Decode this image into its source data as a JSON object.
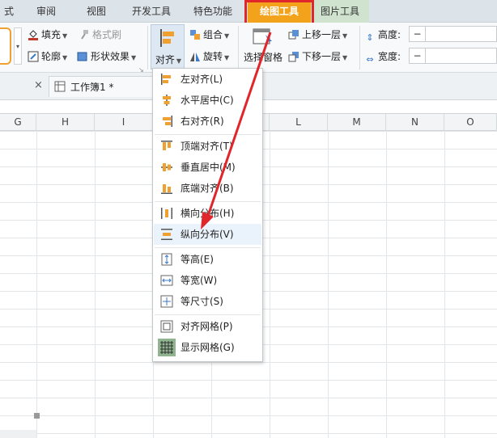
{
  "tabs": [
    {
      "label": "式"
    },
    {
      "label": "审阅"
    },
    {
      "label": "视图"
    },
    {
      "label": "开发工具"
    },
    {
      "label": "特色功能"
    },
    {
      "label": "绘图工具"
    },
    {
      "label": "图片工具"
    }
  ],
  "ribbon": {
    "fill": "填充",
    "format_painter": "格式刷",
    "outline": "轮廓",
    "shape_effect": "形状效果",
    "align": "对齐",
    "group": "组合",
    "rotate": "旋转",
    "selection_pane": "选择窗格",
    "bring_forward": "上移一层",
    "send_backward": "下移一层",
    "height_label": "高度:",
    "width_label": "宽度:",
    "height_value": "",
    "width_value": ""
  },
  "doc": {
    "tab_label": "工作簿1 *"
  },
  "columns": [
    "G",
    "H",
    "I",
    "J",
    "K",
    "L",
    "M",
    "N",
    "O"
  ],
  "menu": {
    "items": [
      {
        "label": "左对齐(L)"
      },
      {
        "label": "水平居中(C)"
      },
      {
        "label": "右对齐(R)"
      },
      {
        "label": "顶端对齐(T)"
      },
      {
        "label": "垂直居中(M)"
      },
      {
        "label": "底端对齐(B)"
      },
      {
        "label": "横向分布(H)"
      },
      {
        "label": "纵向分布(V)"
      },
      {
        "label": "等高(E)"
      },
      {
        "label": "等宽(W)"
      },
      {
        "label": "等尺寸(S)"
      },
      {
        "label": "对齐网格(P)"
      },
      {
        "label": "显示网格(G)"
      }
    ]
  },
  "colors": {
    "highlight_tab": "#f2a31b",
    "annotation": "#e0262a",
    "icon_orange": "#f0a030",
    "icon_blue": "#3c78c8"
  }
}
